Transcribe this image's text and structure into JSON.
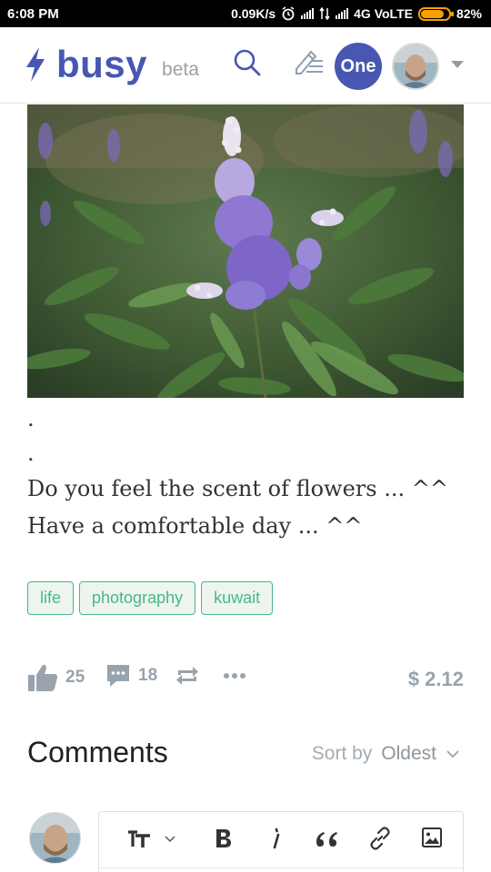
{
  "status_bar": {
    "time": "6:08 PM",
    "net_speed": "0.09K/s",
    "network": "4G VoLTE",
    "battery": "82%",
    "battery_level": 0.82
  },
  "header": {
    "logo_text": "busy",
    "beta_label": "beta",
    "one_label": "One",
    "icons": [
      "bolt-icon",
      "search-icon",
      "write-icon",
      "chevron-down-icon"
    ]
  },
  "post": {
    "body_lines": [
      ".",
      ".",
      "Do you feel the scent of flowers ... ^^",
      "Have a comfortable day ... ^^"
    ],
    "tags": [
      "life",
      "photography",
      "kuwait"
    ],
    "likes": "25",
    "comments": "18",
    "payout": "$ 2.12"
  },
  "comments": {
    "title": "Comments",
    "sort_label": "Sort by",
    "sort_value": "Oldest"
  },
  "editor": {
    "tools": [
      "text-size-icon",
      "bold-icon",
      "italic-icon",
      "quote-icon",
      "link-icon",
      "image-icon"
    ]
  },
  "colors": {
    "brand": "#4757b2",
    "tag_green": "#47b884",
    "muted": "#98a3ad"
  }
}
